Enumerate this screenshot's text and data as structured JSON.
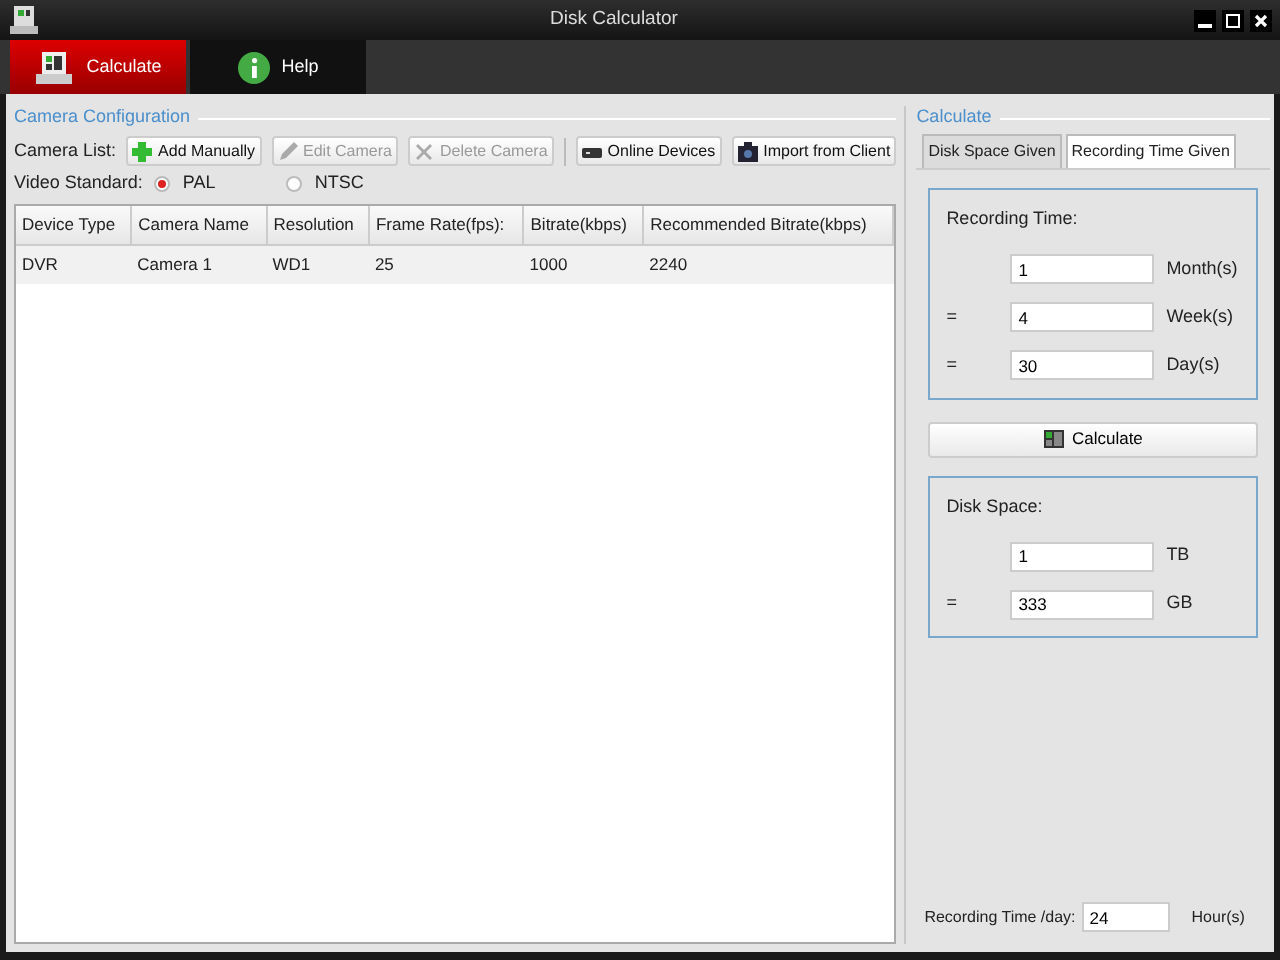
{
  "window": {
    "title": "Disk Calculator"
  },
  "nav_tabs": [
    {
      "label": "Calculate",
      "selected": true,
      "kind": "calculator"
    },
    {
      "label": "Help",
      "selected": false,
      "kind": "info"
    }
  ],
  "camera_configuration": {
    "title": "Camera Configuration",
    "camera_list_label": "Camera List:",
    "toolbar": [
      {
        "label": "Add Manually",
        "disabled": false,
        "kind": "add"
      },
      {
        "label": "Edit Camera",
        "disabled": true,
        "kind": "edit"
      },
      {
        "label": "Delete Camera",
        "disabled": true,
        "kind": "delete"
      },
      {
        "label": "Online Devices",
        "disabled": false,
        "kind": "device"
      },
      {
        "label": "Import from Client",
        "disabled": false,
        "kind": "import"
      }
    ],
    "video_standard_label": "Video Standard:",
    "video_standards": [
      {
        "label": "PAL",
        "selected": true
      },
      {
        "label": "NTSC",
        "selected": false
      }
    ],
    "table": {
      "columns": [
        "Device Type",
        "Camera Name",
        "Resolution",
        "Frame Rate(fps):",
        "Bitrate(kbps)",
        "Recommended Bitrate(kbps)"
      ],
      "rows": [
        [
          "DVR",
          "Camera 1",
          "WD1",
          "25",
          "1000",
          "2240"
        ]
      ]
    }
  },
  "calculate": {
    "title": "Calculate",
    "tabs": [
      {
        "label": "Disk Space Given",
        "selected": false
      },
      {
        "label": "Recording Time Given",
        "selected": true
      }
    ],
    "recording_time": {
      "title": "Recording Time:",
      "fields": [
        {
          "value": "1",
          "unit": "Month(s)"
        },
        {
          "prefix": "=",
          "value": "4",
          "unit": "Week(s)"
        },
        {
          "prefix": "=",
          "value": "30",
          "unit": "Day(s)"
        }
      ]
    },
    "button": "Calculate",
    "disk_space": {
      "title": "Disk Space:",
      "fields": [
        {
          "value": "1",
          "unit": "TB"
        },
        {
          "prefix": "=",
          "value": "333",
          "unit": "GB"
        }
      ]
    },
    "per_day": {
      "label": "Recording Time /day:",
      "value": "24",
      "unit": "Hour(s)"
    }
  }
}
